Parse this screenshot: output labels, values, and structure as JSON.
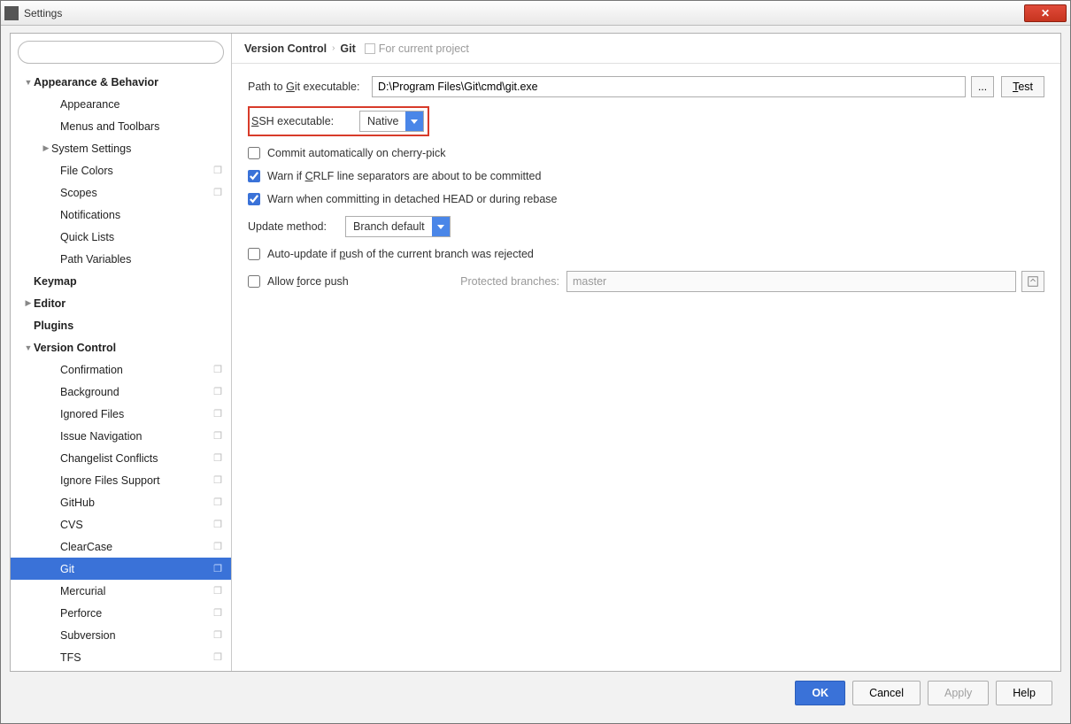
{
  "window": {
    "title": "Settings"
  },
  "search": {
    "placeholder": ""
  },
  "sidebar": [
    {
      "label": "Appearance & Behavior",
      "bold": true,
      "arrow": "down",
      "indent": 0,
      "copy": false
    },
    {
      "label": "Appearance",
      "indent": 1,
      "copy": false
    },
    {
      "label": "Menus and Toolbars",
      "indent": 1,
      "copy": false
    },
    {
      "label": "System Settings",
      "arrow": "right",
      "indent": 1,
      "copy": false
    },
    {
      "label": "File Colors",
      "indent": 1,
      "copy": true
    },
    {
      "label": "Scopes",
      "indent": 1,
      "copy": true
    },
    {
      "label": "Notifications",
      "indent": 1,
      "copy": false
    },
    {
      "label": "Quick Lists",
      "indent": 1,
      "copy": false
    },
    {
      "label": "Path Variables",
      "indent": 1,
      "copy": false
    },
    {
      "label": "Keymap",
      "bold": true,
      "indent": 0,
      "copy": false
    },
    {
      "label": "Editor",
      "bold": true,
      "arrow": "right",
      "indent": 0,
      "copy": false
    },
    {
      "label": "Plugins",
      "bold": true,
      "indent": 0,
      "copy": false
    },
    {
      "label": "Version Control",
      "bold": true,
      "arrow": "down",
      "indent": 0,
      "copy": false
    },
    {
      "label": "Confirmation",
      "indent": 1,
      "copy": true
    },
    {
      "label": "Background",
      "indent": 1,
      "copy": true
    },
    {
      "label": "Ignored Files",
      "indent": 1,
      "copy": true
    },
    {
      "label": "Issue Navigation",
      "indent": 1,
      "copy": true
    },
    {
      "label": "Changelist Conflicts",
      "indent": 1,
      "copy": true
    },
    {
      "label": "Ignore Files Support",
      "indent": 1,
      "copy": true
    },
    {
      "label": "GitHub",
      "indent": 1,
      "copy": true
    },
    {
      "label": "CVS",
      "indent": 1,
      "copy": true
    },
    {
      "label": "ClearCase",
      "indent": 1,
      "copy": true
    },
    {
      "label": "Git",
      "indent": 1,
      "copy": true,
      "selected": true
    },
    {
      "label": "Mercurial",
      "indent": 1,
      "copy": true
    },
    {
      "label": "Perforce",
      "indent": 1,
      "copy": true
    },
    {
      "label": "Subversion",
      "indent": 1,
      "copy": true
    },
    {
      "label": "TFS",
      "indent": 1,
      "copy": true
    }
  ],
  "breadcrumb": {
    "root": "Version Control",
    "leaf": "Git",
    "hint": "For current project"
  },
  "git": {
    "path_label": "Path to Git executable:",
    "path_value": "D:\\Program Files\\Git\\cmd\\git.exe",
    "browse": "...",
    "test": "Test",
    "ssh_label": "SSH executable:",
    "ssh_value": "Native",
    "cherry_pick": "Commit automatically on cherry-pick",
    "crlf_warn": "Warn if CRLF line separators are about to be committed",
    "detached_warn": "Warn when committing in detached HEAD or during rebase",
    "update_label": "Update method:",
    "update_value": "Branch default",
    "auto_update": "Auto-update if push of the current branch was rejected",
    "allow_force": "Allow force push",
    "protected_label": "Protected branches:",
    "protected_value": "master"
  },
  "footer": {
    "ok": "OK",
    "cancel": "Cancel",
    "apply": "Apply",
    "help": "Help"
  }
}
